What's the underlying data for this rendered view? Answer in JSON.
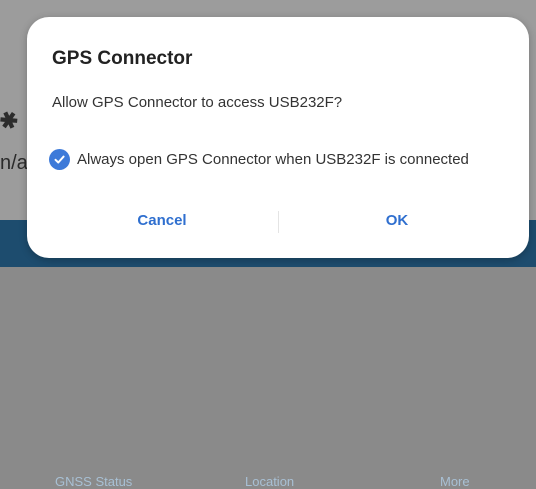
{
  "background": {
    "side_text": "n/a",
    "tabs": [
      "GNSS Status",
      "Location",
      "More"
    ]
  },
  "dialog": {
    "title": "GPS Connector",
    "message": "Allow GPS Connector to access USB232F?",
    "checkbox": {
      "label": "Always open GPS Connector when USB232F is connected",
      "checked": true
    },
    "buttons": {
      "cancel": "Cancel",
      "ok": "OK"
    }
  },
  "colors": {
    "accent": "#2f6fcf",
    "checkbox": "#3d7ad9",
    "bottom_bar": "#1d4c6e"
  }
}
